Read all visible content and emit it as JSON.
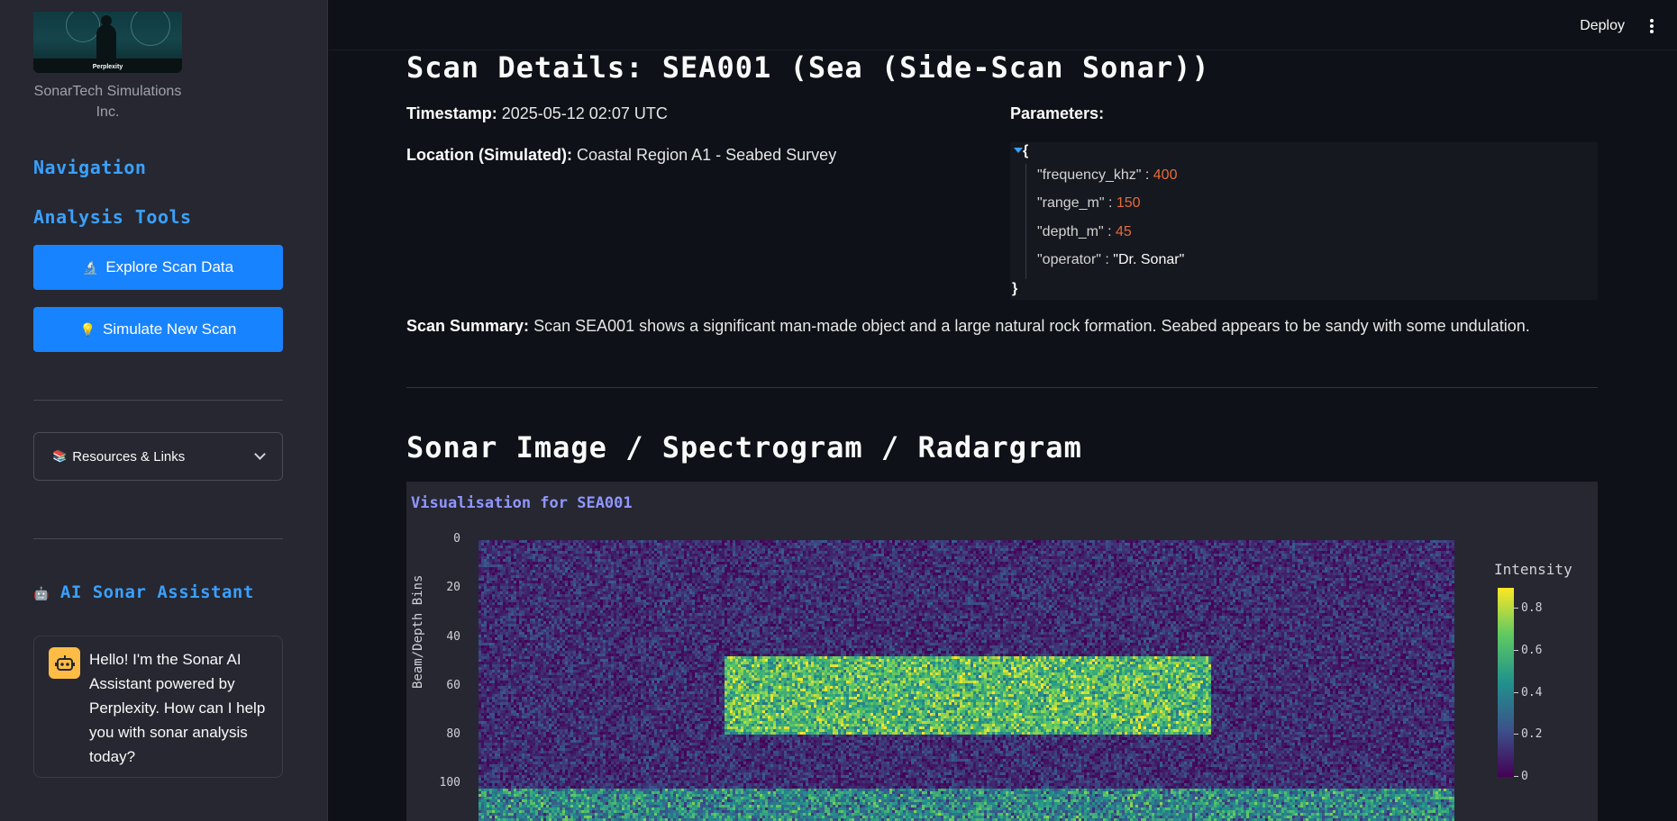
{
  "sidebar": {
    "logo_text": "Perplexity",
    "company": "SonarTech Simulations Inc.",
    "nav_heading": "Navigation",
    "tools_heading": "Analysis Tools",
    "explore_icon": "🔬",
    "explore_label": "Explore Scan Data",
    "simulate_icon": "💡",
    "simulate_label": "Simulate New Scan",
    "resources_icon": "📚",
    "resources_label": "Resources & Links",
    "assistant_icon": "🤖",
    "assistant_heading": "AI Sonar Assistant",
    "assistant_message": "Hello! I'm the Sonar AI Assistant powered by Perplexity. How can I help you with sonar analysis today?"
  },
  "header": {
    "deploy_label": "Deploy"
  },
  "scan": {
    "title": "Scan Details: SEA001 (Sea (Side-Scan Sonar))",
    "timestamp_label": "Timestamp:",
    "timestamp_value": "2025-05-12 02:07 UTC",
    "location_label": "Location (Simulated):",
    "location_value": "Coastal Region A1 - Seabed Survey",
    "parameters_label": "Parameters:",
    "parameters": [
      {
        "key": "\"frequency_khz\"",
        "value": "400",
        "kind": "number"
      },
      {
        "key": "\"range_m\"",
        "value": "150",
        "kind": "number"
      },
      {
        "key": "\"depth_m\"",
        "value": "45",
        "kind": "number"
      },
      {
        "key": "\"operator\"",
        "value": "\"Dr. Sonar\"",
        "kind": "string"
      }
    ],
    "summary_label": "Scan Summary:",
    "summary_value": "Scan SEA001 shows a significant man-made object and a large natural rock formation. Seabed appears to be sandy with some undulation."
  },
  "visual": {
    "section_title": "Sonar Image / Spectrogram / Radargram",
    "chart_title": "Visualisation for SEA001"
  },
  "chart_data": {
    "type": "heatmap",
    "title": "Visualisation for SEA001",
    "xlabel": "",
    "ylabel": "Beam/Depth Bins",
    "y_ticks": [
      "0",
      "20",
      "40",
      "60",
      "80",
      "100"
    ],
    "y_range_visible": [
      0,
      115
    ],
    "colorbar_title": "Intensity",
    "colorbar_ticks": [
      "0",
      "0.2",
      "0.4",
      "0.6",
      "0.8"
    ],
    "zlim": [
      0,
      0.9
    ],
    "colorscale": "viridis",
    "regions": [
      {
        "label": "background noise",
        "rows": [
          0,
          102
        ],
        "cols": [
          0,
          1
        ],
        "mean_intensity": 0.12
      },
      {
        "label": "object",
        "rows": [
          48,
          80
        ],
        "cols": [
          0.25,
          0.75
        ],
        "mean_intensity": 0.62
      },
      {
        "label": "seabed band",
        "rows": [
          102,
          115
        ],
        "cols": [
          0,
          1
        ],
        "mean_intensity": 0.42
      }
    ]
  }
}
